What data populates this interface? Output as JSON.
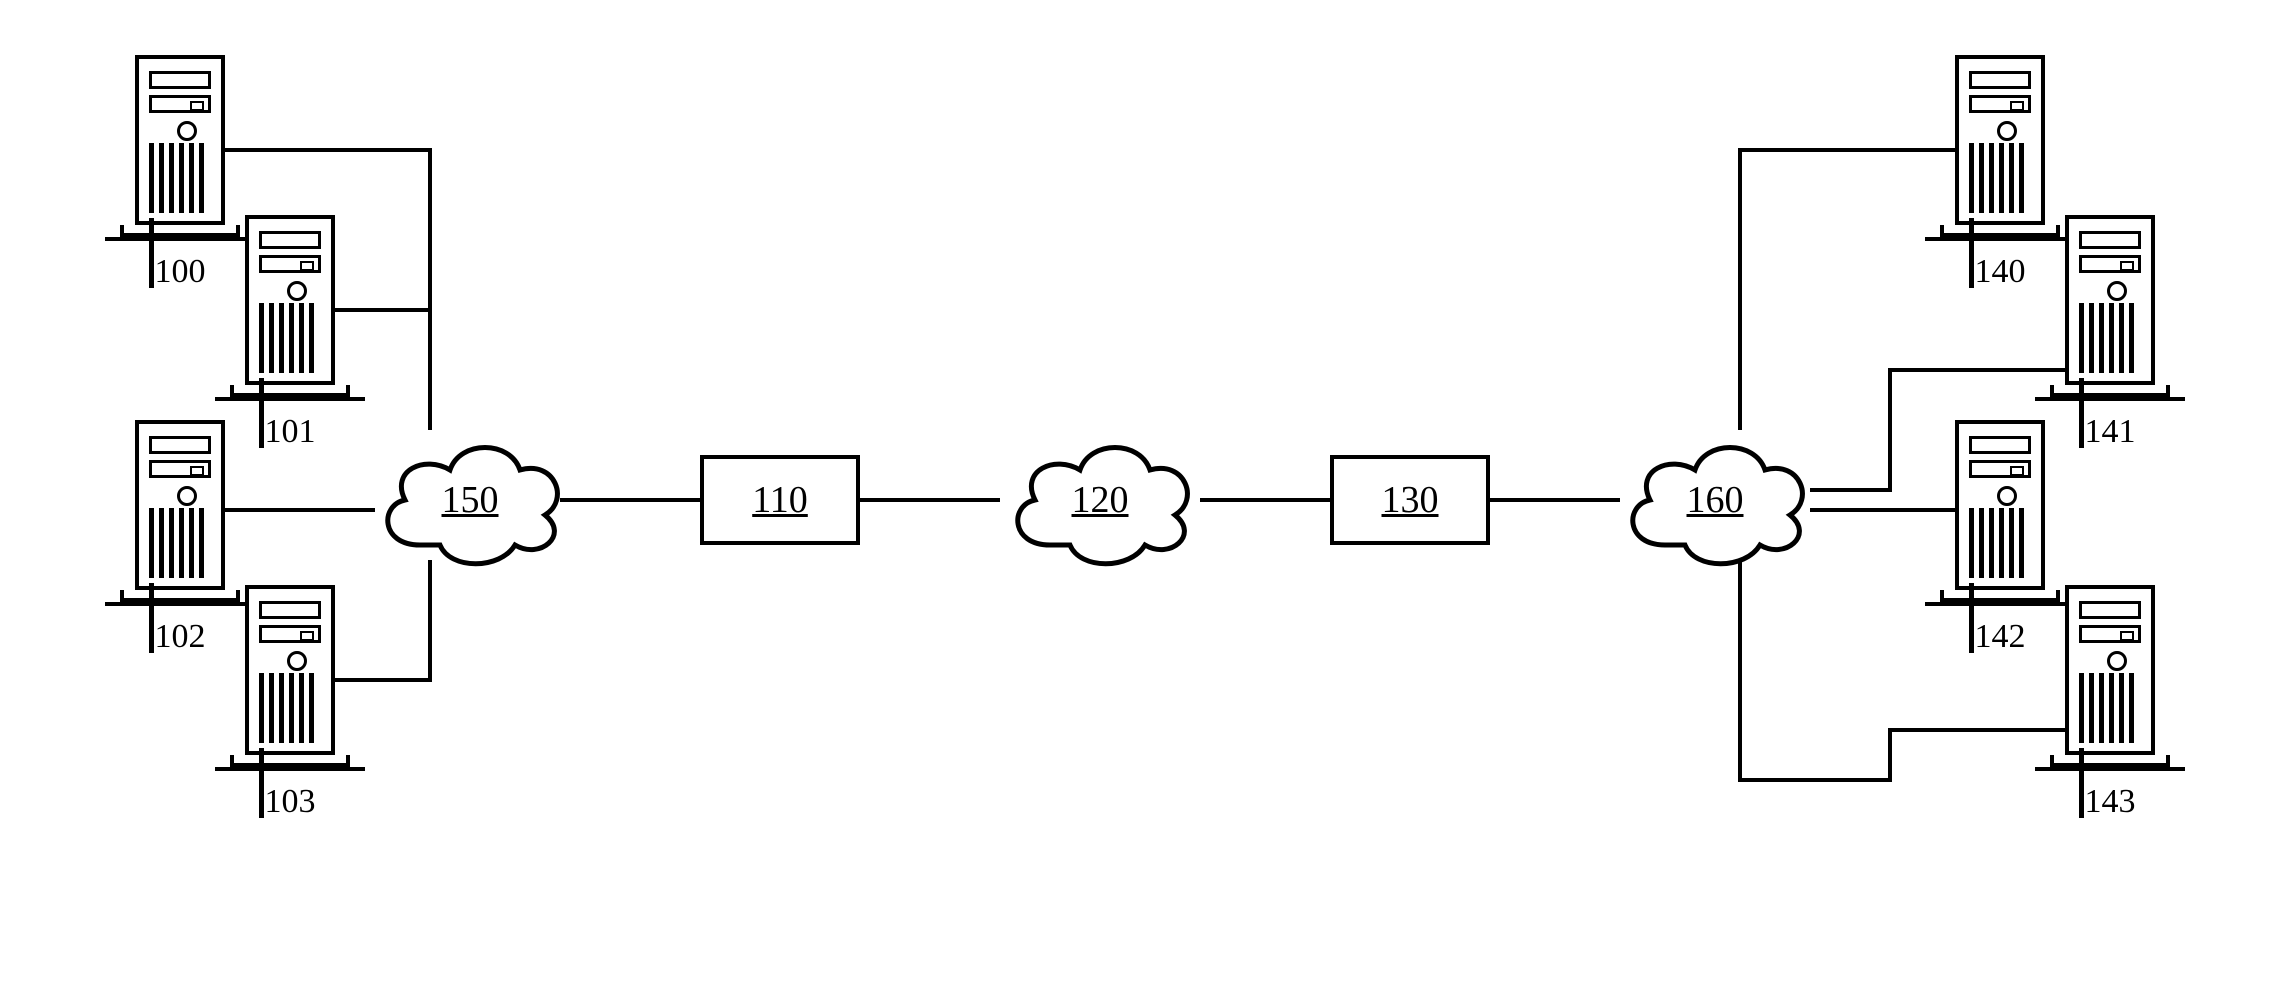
{
  "nodes": {
    "server_left_1": {
      "label": "100"
    },
    "server_left_2": {
      "label": "101"
    },
    "server_left_3": {
      "label": "102"
    },
    "server_left_4": {
      "label": "103"
    },
    "server_right_1": {
      "label": "140"
    },
    "server_right_2": {
      "label": "141"
    },
    "server_right_3": {
      "label": "142"
    },
    "server_right_4": {
      "label": "143"
    },
    "cloud_left": {
      "label": "150"
    },
    "cloud_center": {
      "label": "120"
    },
    "cloud_right": {
      "label": "160"
    },
    "box_left": {
      "label": "110"
    },
    "box_right": {
      "label": "130"
    }
  },
  "chart_data": {
    "type": "network-diagram",
    "title": "",
    "nodes": [
      {
        "id": "100",
        "type": "server"
      },
      {
        "id": "101",
        "type": "server"
      },
      {
        "id": "102",
        "type": "server"
      },
      {
        "id": "103",
        "type": "server"
      },
      {
        "id": "150",
        "type": "cloud"
      },
      {
        "id": "110",
        "type": "box"
      },
      {
        "id": "120",
        "type": "cloud"
      },
      {
        "id": "130",
        "type": "box"
      },
      {
        "id": "160",
        "type": "cloud"
      },
      {
        "id": "140",
        "type": "server"
      },
      {
        "id": "141",
        "type": "server"
      },
      {
        "id": "142",
        "type": "server"
      },
      {
        "id": "143",
        "type": "server"
      }
    ],
    "edges": [
      [
        "100",
        "150"
      ],
      [
        "101",
        "150"
      ],
      [
        "102",
        "150"
      ],
      [
        "103",
        "150"
      ],
      [
        "150",
        "110"
      ],
      [
        "110",
        "120"
      ],
      [
        "120",
        "130"
      ],
      [
        "130",
        "160"
      ],
      [
        "160",
        "140"
      ],
      [
        "160",
        "141"
      ],
      [
        "160",
        "142"
      ],
      [
        "160",
        "143"
      ]
    ]
  }
}
